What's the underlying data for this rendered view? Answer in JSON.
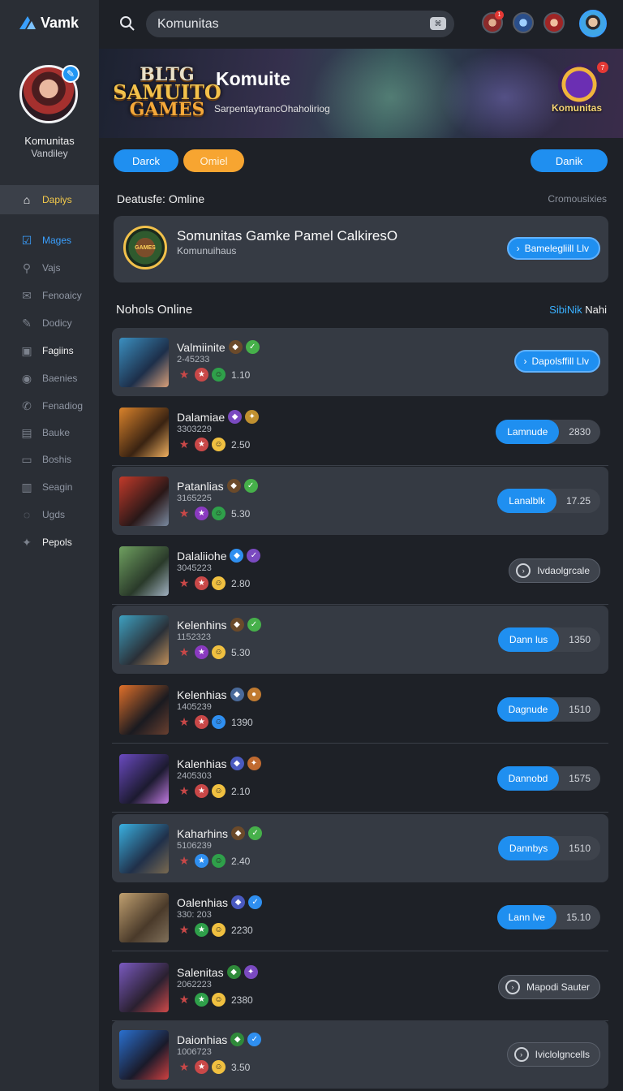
{
  "app": {
    "logo_text": "Vamk"
  },
  "profile": {
    "name": "Komunitas",
    "sub": "Vandiley"
  },
  "sidebar": {
    "items": [
      {
        "label": "Dapiys",
        "icon": "home-icon",
        "glyph": "⌂",
        "state": "active"
      },
      {
        "label": "Mages",
        "icon": "check-square-icon",
        "glyph": "☑",
        "state": "blue"
      },
      {
        "label": "Vajs",
        "icon": "search-people-icon",
        "glyph": "⚲",
        "state": ""
      },
      {
        "label": "Fenoaicy",
        "icon": "chat-icon",
        "glyph": "✉",
        "state": ""
      },
      {
        "label": "Dodicy",
        "icon": "edit-icon",
        "glyph": "✎",
        "state": ""
      },
      {
        "label": "Fagiins",
        "icon": "square-icon",
        "glyph": "▣",
        "state": "light"
      },
      {
        "label": "Baenies",
        "icon": "globe-icon",
        "glyph": "◉",
        "state": ""
      },
      {
        "label": "Fenadiog",
        "icon": "message-icon",
        "glyph": "✆",
        "state": ""
      },
      {
        "label": "Bauke",
        "icon": "chart-icon",
        "glyph": "▤",
        "state": ""
      },
      {
        "label": "Boshis",
        "icon": "window-icon",
        "glyph": "▭",
        "state": ""
      },
      {
        "label": "Seagin",
        "icon": "book-icon",
        "glyph": "▥",
        "state": ""
      },
      {
        "label": "Ugds",
        "icon": "drop-icon",
        "glyph": "◌",
        "state": ""
      },
      {
        "label": "Pepols",
        "icon": "badge-icon",
        "glyph": "✦",
        "state": "light"
      }
    ]
  },
  "search": {
    "value": "Komunitas"
  },
  "banner": {
    "logo_line1": "BLTG",
    "logo_line2": "SAMUITO",
    "logo_line3": "GAMES",
    "title": "Komuite",
    "subtitle": "SarpentaytrancOhaholiriog",
    "badge_text": "Komunitas"
  },
  "filters": {
    "left1": "Darck",
    "left2": "Omiel",
    "right": "Danik"
  },
  "status": {
    "label": "Deatusfe: Omline",
    "link": "Cromousixies"
  },
  "featured": {
    "title": "Somunitas Gamke Pamel CalkiresO",
    "subtitle": "Komunuihaus",
    "action": "Bamelegliill Llv"
  },
  "section": {
    "title": "Nohols Online",
    "link_blue": "SibiNik",
    "link_white": "Nahi"
  },
  "colors": {
    "accent": "#1f8ff0",
    "orange": "#f7a531",
    "active_text": "#f3c94a"
  },
  "rows": [
    {
      "name": "Valmiinite",
      "date": "2-45233",
      "value": "1.10",
      "action": "Dapolsffill Llv",
      "count": "",
      "kind": "featured"
    },
    {
      "name": "Dalamiae",
      "date": "3303229",
      "value": "2.50",
      "action": "Lamnude",
      "count": "2830",
      "kind": "split"
    },
    {
      "name": "Patanlias",
      "date": "3165225",
      "value": "5.30",
      "action": "Lanalblk",
      "count": "17.25",
      "kind": "split"
    },
    {
      "name": "Dalaliiohe",
      "date": "3045223",
      "value": "2.80",
      "action": "Ivdaolgrcale",
      "count": "",
      "kind": "outline"
    },
    {
      "name": "Kelenhins",
      "date": "1152323",
      "value": "5.30",
      "action": "Dann lus",
      "count": "1350",
      "kind": "split"
    },
    {
      "name": "Kelenhias",
      "date": "1405239",
      "value": "1390",
      "action": "Dagnude",
      "count": "1510",
      "kind": "split"
    },
    {
      "name": "Kalenhias",
      "date": "2405303",
      "value": "2.10",
      "action": "Dannobd",
      "count": "1575",
      "kind": "split"
    },
    {
      "name": "Kaharhins",
      "date": "5106239",
      "value": "2.40",
      "action": "Dannbys",
      "count": "1510",
      "kind": "split"
    },
    {
      "name": "Oalenhias",
      "date": "330: 203",
      "value": "2230",
      "action": "Lann lve",
      "count": "15.10",
      "kind": "split"
    },
    {
      "name": "Salenitas",
      "date": "2062223",
      "value": "2380",
      "action": "Mapodi Sauter",
      "count": "",
      "kind": "outline"
    },
    {
      "name": "Daionhias",
      "date": "1006723",
      "value": "3.50",
      "action": "Iviclolgncells",
      "count": "",
      "kind": "outline"
    }
  ]
}
